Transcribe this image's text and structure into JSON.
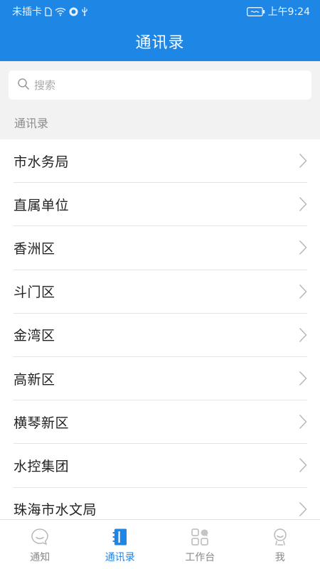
{
  "status_bar": {
    "carrier": "未插卡",
    "time": "上午9:24"
  },
  "header": {
    "title": "通讯录"
  },
  "search": {
    "placeholder": "搜索",
    "value": ""
  },
  "section": {
    "title": "通讯录"
  },
  "contacts": [
    {
      "label": "市水务局"
    },
    {
      "label": "直属单位"
    },
    {
      "label": "香洲区"
    },
    {
      "label": "斗门区"
    },
    {
      "label": "金湾区"
    },
    {
      "label": "高新区"
    },
    {
      "label": "横琴新区"
    },
    {
      "label": "水控集团"
    },
    {
      "label": "珠海市水文局"
    }
  ],
  "tabs": [
    {
      "label": "通知",
      "icon": "chat-bubble-icon",
      "active": false
    },
    {
      "label": "通讯录",
      "icon": "contacts-book-icon",
      "active": true
    },
    {
      "label": "工作台",
      "icon": "workbench-grid-icon",
      "active": false
    },
    {
      "label": "我",
      "icon": "profile-icon",
      "active": false
    }
  ],
  "colors": {
    "primary": "#1e86e5",
    "background": "#f2f2f2",
    "inactive": "#8a8a8a"
  }
}
